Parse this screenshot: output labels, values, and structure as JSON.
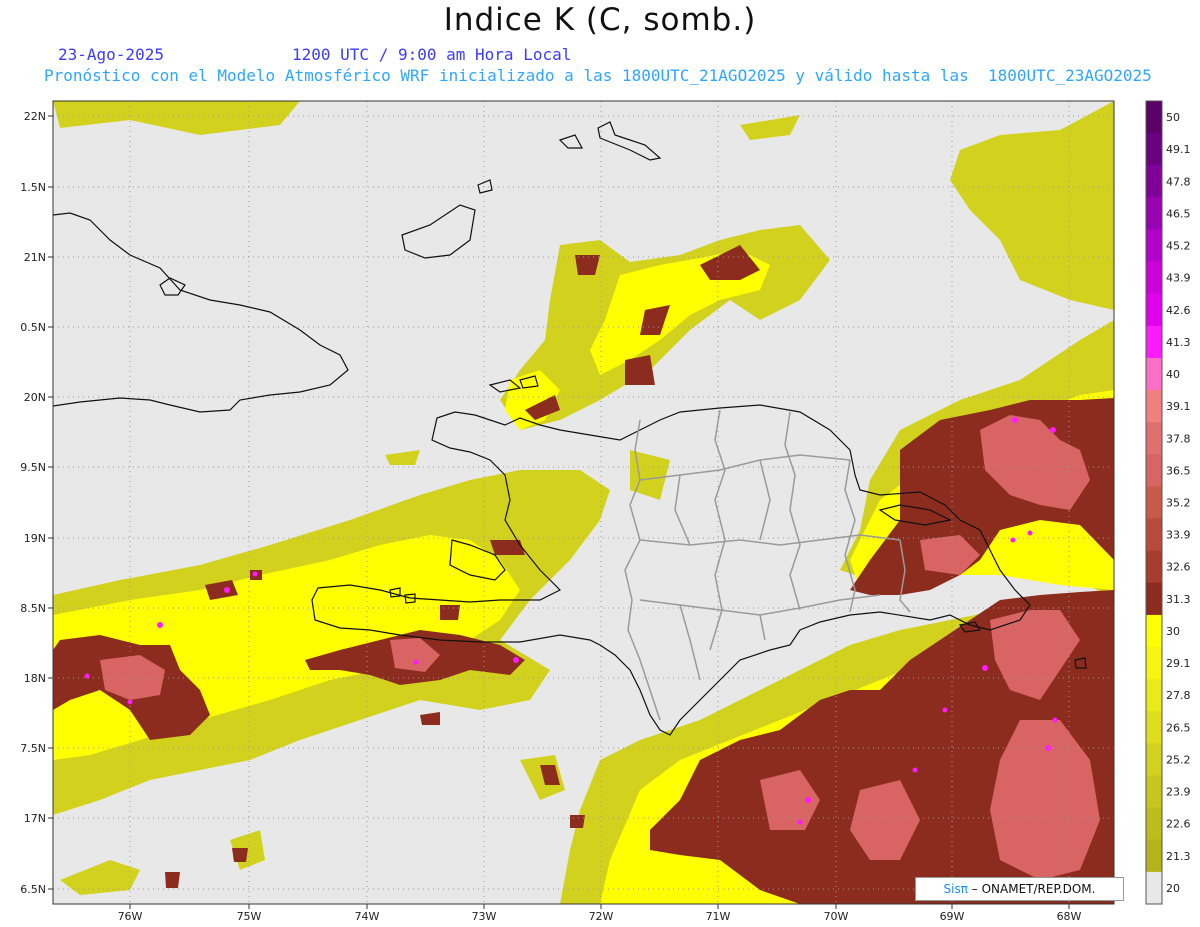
{
  "title": "Indice K (C, somb.)",
  "header": {
    "date": "23-Ago-2025",
    "time": "1200 UTC / 9:00 am Hora Local",
    "run": "Pronóstico con el Modelo Atmosférico WRF inicializado a las 1800UTC_21AGO2025 y válido hasta las  1800UTC_23AGO2025"
  },
  "axes": {
    "lat_labels": [
      "22N",
      "1.5N",
      "21N",
      "0.5N",
      "20N",
      "9.5N",
      "19N",
      "8.5N",
      "18N",
      "7.5N",
      "17N",
      "6.5N"
    ],
    "lon_labels": [
      "76W",
      "75W",
      "74W",
      "73W",
      "72W",
      "71W",
      "70W",
      "69W",
      "68W"
    ]
  },
  "colorbar": {
    "labels": [
      "50",
      "49.1",
      "47.8",
      "46.5",
      "45.2",
      "43.9",
      "42.6",
      "41.3",
      "40",
      "39.1",
      "37.8",
      "36.5",
      "35.2",
      "33.9",
      "32.6",
      "31.3",
      "30",
      "29.1",
      "27.8",
      "26.5",
      "25.2",
      "23.9",
      "22.6",
      "21.3",
      "20"
    ],
    "colors": [
      "#5a0066",
      "#6b0080",
      "#800099",
      "#9900b3",
      "#b300cc",
      "#cc00dd",
      "#e000ee",
      "#ff1aff",
      "#ff6ec7",
      "#f08080",
      "#e07070",
      "#d86464",
      "#c85a4a",
      "#b84a3c",
      "#a83c30",
      "#8c2c1e",
      "#ffff00",
      "#f5f510",
      "#eaea18",
      "#dede1c",
      "#d2d21e",
      "#c6c61e",
      "#bcbc1c",
      "#b4b41a",
      "#e8e8e8"
    ]
  },
  "colors": {
    "yellow_low": "#d2d21e",
    "yellow_high": "#ffff00",
    "brown": "#8c2c1e",
    "salmon": "#d86464",
    "magenta": "#ff1aff",
    "background": "#e8e8e8"
  },
  "credit": {
    "sis": "Sisπ",
    "org": " – ONAMET/REP.DOM."
  }
}
